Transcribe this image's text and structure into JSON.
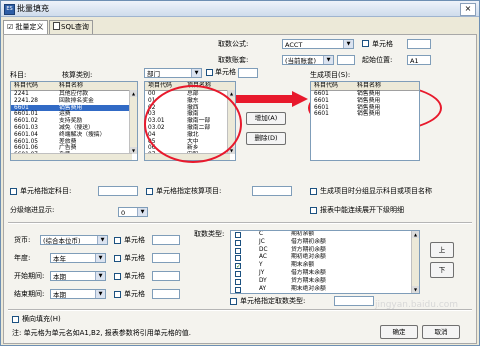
{
  "window": {
    "title": "批量填充",
    "close_glyph": "×",
    "icon_text": "ES"
  },
  "tabs": [
    {
      "label": "☑ 批量定义"
    },
    {
      "label": "SQL查询"
    }
  ],
  "top": {
    "fetch_formula_label": "取数公式:",
    "fetch_formula_value": "ACCT",
    "fetch_account_label": "取数账套:",
    "fetch_account_value": "(当前账套)",
    "cell_checkbox_label": "单元格",
    "start_pos_label": "起始位置:",
    "start_pos_value": "A1"
  },
  "account_list": {
    "label": "科目:",
    "col_code": "科目代码",
    "col_name": "科目名称",
    "rows": [
      {
        "code": "2241",
        "name": "其他应付款"
      },
      {
        "code": "2241.28",
        "name": "回款排名奖金"
      },
      {
        "code": "6601",
        "name": "销售费用"
      },
      {
        "code": "6601.01",
        "name": "运费"
      },
      {
        "code": "6601.02",
        "name": "支持奖励"
      },
      {
        "code": "6601.03",
        "name": "减免（搜送）"
      },
      {
        "code": "6601.04",
        "name": "终端解决（搜搞）"
      },
      {
        "code": "6601.05",
        "name": "差旅费"
      },
      {
        "code": "6601.06",
        "name": "广告费"
      },
      {
        "code": "6601.07",
        "name": "杂费"
      }
    ],
    "selected_index": 2
  },
  "item_list": {
    "label": "核算类别:",
    "category_value": "部门",
    "cell_checkbox_label": "单元格",
    "col_code": "项目代码",
    "col_name": "项目名称",
    "rows": [
      {
        "code": "00",
        "name": "总部"
      },
      {
        "code": "01",
        "name": "撤东"
      },
      {
        "code": "02",
        "name": "撤西"
      },
      {
        "code": "03",
        "name": "撤南"
      },
      {
        "code": "03.01",
        "name": "撤南一部"
      },
      {
        "code": "03.02",
        "name": "撤南二部"
      },
      {
        "code": "04",
        "name": "撤北"
      },
      {
        "code": "05",
        "name": "大中"
      },
      {
        "code": "06",
        "name": "新乡"
      },
      {
        "code": "07",
        "name": "安阳"
      }
    ]
  },
  "middle_buttons": {
    "add": "增加(A)",
    "delete": "删除(D)"
  },
  "generated_list": {
    "label": "生成项目(S):",
    "col_code": "科目代码",
    "col_name": "科目名称",
    "rows": [
      {
        "code": "6601",
        "name": "销售费用"
      },
      {
        "code": "6601",
        "name": "销售费用"
      },
      {
        "code": "6601",
        "name": "销售费用"
      },
      {
        "code": "6601",
        "name": "销售费用"
      }
    ]
  },
  "options": {
    "cell_assign_account": "单元格指定科目:",
    "cell_assign_item": "单元格指定核算项目:",
    "gen_item_show_account": "生成项目时分组显示科目或项目名称",
    "include_unposted": "报表中能连续展开下级明细",
    "level_display_label": "分级缩进显示:",
    "level_display_value": "0"
  },
  "bottom": {
    "currency_label": "货币:",
    "currency_value": "(综合本位币)",
    "year_label": "年度:",
    "year_value": "本年",
    "start_period_label": "开始期间:",
    "start_period_value": "本期",
    "end_period_label": "结束期间:",
    "end_period_value": "本期",
    "cell_label": "单元格",
    "fetch_type_label": "取数类型:",
    "fetch_types": [
      {
        "code": "C",
        "name": "期初余额",
        "checked": false
      },
      {
        "code": "JC",
        "name": "借方期初余额",
        "checked": false
      },
      {
        "code": "DC",
        "name": "贷方期初余额",
        "checked": false
      },
      {
        "code": "AC",
        "name": "期初绝对余额",
        "checked": false
      },
      {
        "code": "Y",
        "name": "期末余额",
        "checked": true
      },
      {
        "code": "JY",
        "name": "借方期末余额",
        "checked": false
      },
      {
        "code": "DY",
        "name": "贷方期末余额",
        "checked": false
      },
      {
        "code": "AY",
        "name": "期末绝对余额",
        "checked": false
      }
    ],
    "cell_fetch_type": "单元格指定取数类型:",
    "up": "上",
    "down": "下",
    "horizontal_fill": "横向填充(H)",
    "note": "注: 单元格为单元名如A1,B2, 报表参数将引用单元格的值.",
    "ok": "确定",
    "cancel": "取消"
  },
  "watermark": "jingyan.baidu.com"
}
